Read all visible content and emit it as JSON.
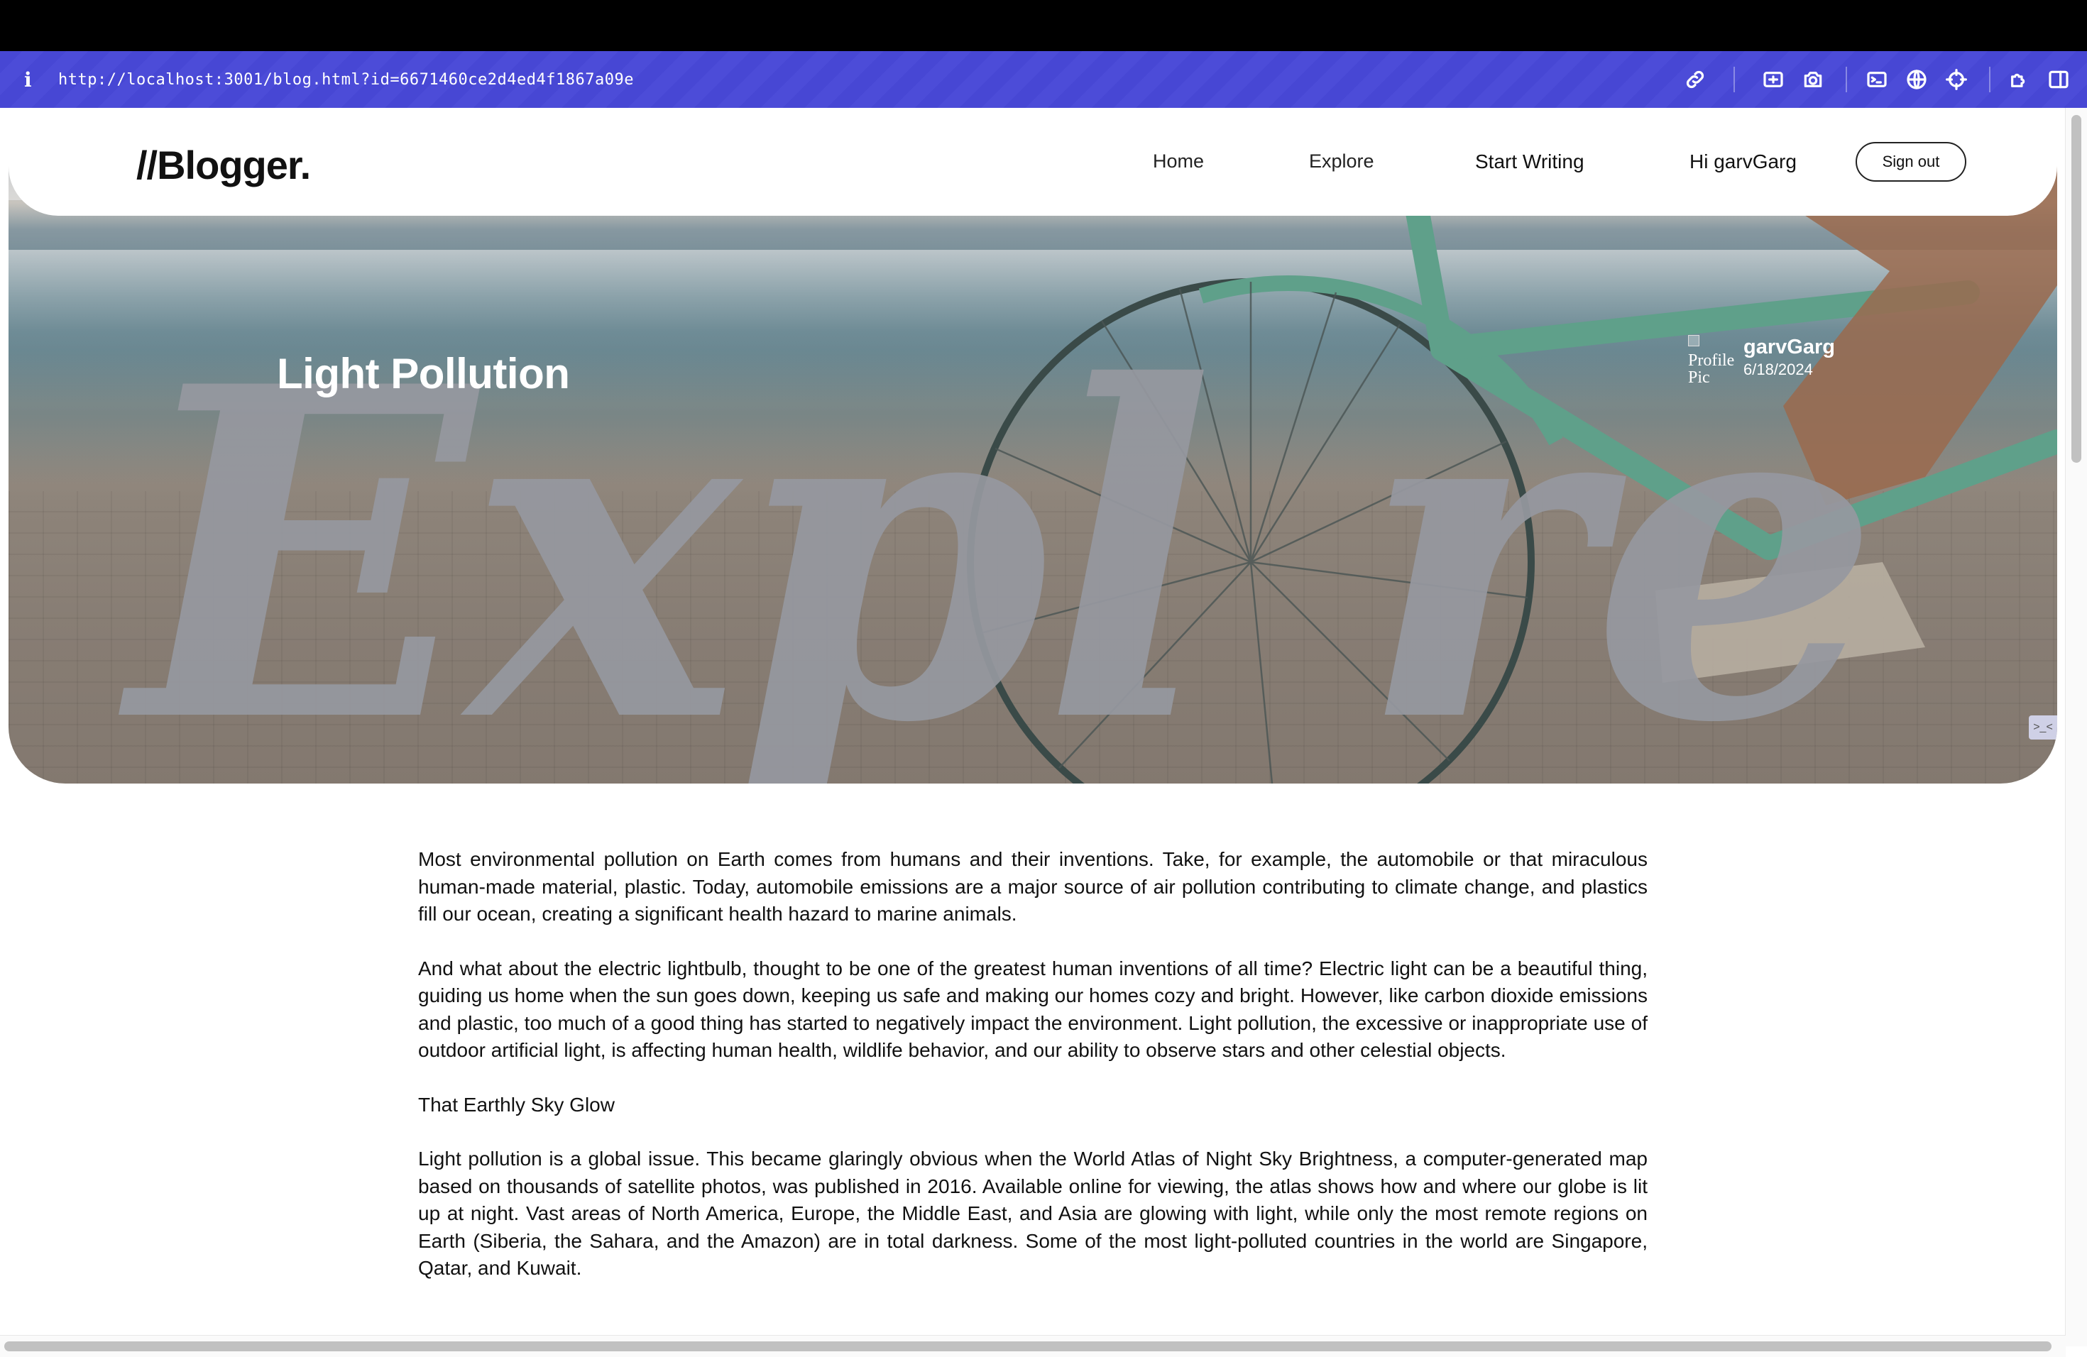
{
  "browser": {
    "url": "http://localhost:3001/blog.html?id=6671460ce2d4ed4f1867a09e",
    "icons": [
      "info-icon",
      "link-icon",
      "screen-capture-icon",
      "camera-icon",
      "terminal-icon",
      "globe-icon",
      "crosshair-icon",
      "extensions-icon",
      "sidebar-icon"
    ]
  },
  "navbar": {
    "logo": "//Blogger.",
    "links": [
      "Home",
      "Explore",
      "Start Writing",
      "Hi garvGarg"
    ],
    "signout_label": "Sign out"
  },
  "hero": {
    "background_script_text": "Expl re",
    "title": "Light Pollution",
    "author": {
      "avatar_alt": "Profile Pic",
      "name": "garvGarg",
      "date": "6/18/2024"
    },
    "corner_badge": ">_<"
  },
  "article": {
    "paragraphs": [
      "Most environmental pollution on Earth comes from humans and their inventions. Take, for example, the automobile or that miraculous human-made material, plastic. Today, automobile emissions are a major source of air pollution contributing to climate change, and plastics fill our ocean, creating a significant health hazard to marine animals.",
      "And what about the electric lightbulb, thought to be one of the greatest human inventions of all time? Electric light can be a beautiful thing, guiding us home when the sun goes down, keeping us safe and making our homes cozy and bright. However, like carbon dioxide emissions and plastic, too much of a good thing has started to negatively impact the environment. Light pollution, the excessive or inappropriate use of outdoor artificial light, is affecting human health, wildlife behavior, and our ability to observe stars and other celestial objects.",
      "That Earthly Sky Glow",
      "Light pollution is a global issue. This became glaringly obvious when the World Atlas of Night Sky Brightness, a computer-generated map based on thousands of satellite photos, was published in 2016. Available online for viewing, the atlas shows how and where our globe is lit up at night. Vast areas of North America, Europe, the Middle East, and Asia are glowing with light, while only the most remote regions on Earth (Siberia, the Sahara, and the Amazon) are in total darkness. Some of the most light-polluted countries in the world are Singapore, Qatar, and Kuwait."
    ]
  },
  "colors": {
    "toolbar": "#4747d4",
    "text": "#111111",
    "background": "#ffffff"
  }
}
